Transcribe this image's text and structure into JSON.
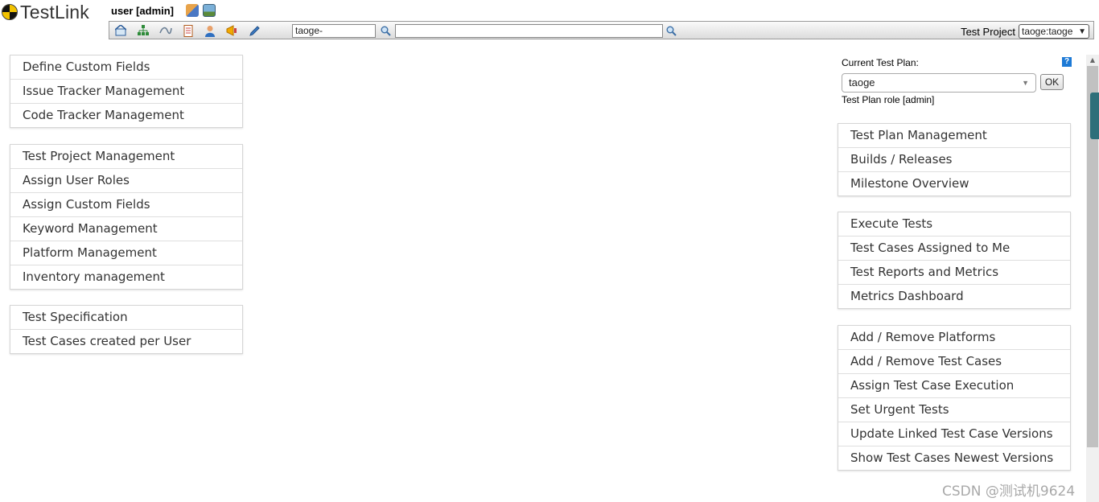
{
  "header": {
    "logo_text": "TestLink",
    "user_label": "user [admin]",
    "icons": [
      "logout-icon",
      "desktop-icon"
    ]
  },
  "toolbar": {
    "icons": [
      "home-icon",
      "tree-icon",
      "link-icon",
      "notebook-icon",
      "user-icon",
      "megaphone-icon",
      "pencil-icon"
    ],
    "search_prefix_value": "taoge-",
    "search_text_value": "",
    "test_project_label": "Test Project",
    "test_project_value": "taoge:taoge"
  },
  "left_groups": [
    {
      "items": [
        "Define Custom Fields",
        "Issue Tracker Management",
        "Code Tracker Management"
      ]
    },
    {
      "items": [
        "Test Project Management",
        "Assign User Roles",
        "Assign Custom Fields",
        "Keyword Management",
        "Platform Management",
        "Inventory management"
      ]
    },
    {
      "items": [
        "Test Specification",
        "Test Cases created per User"
      ]
    }
  ],
  "plan_panel": {
    "label": "Current Test Plan:",
    "help": "?",
    "selected_plan": "taoge",
    "ok_label": "OK",
    "role": "Test Plan role [admin]"
  },
  "right_groups": [
    {
      "items": [
        "Test Plan Management",
        "Builds / Releases",
        "Milestone Overview"
      ]
    },
    {
      "items": [
        "Execute Tests",
        "Test Cases Assigned to Me",
        "Test Reports and Metrics",
        "Metrics Dashboard"
      ]
    },
    {
      "items": [
        "Add / Remove Platforms",
        "Add / Remove Test Cases",
        "Assign Test Case Execution",
        "Set Urgent Tests",
        "Update Linked Test Case Versions",
        "Show Test Cases Newest Versions"
      ]
    }
  ],
  "watermark": "CSDN @测试机9624",
  "colors": {
    "accent": "#1d7ad6",
    "logo_yellow": "#f2c200",
    "toolbar_bg": "#dcdcdc"
  }
}
